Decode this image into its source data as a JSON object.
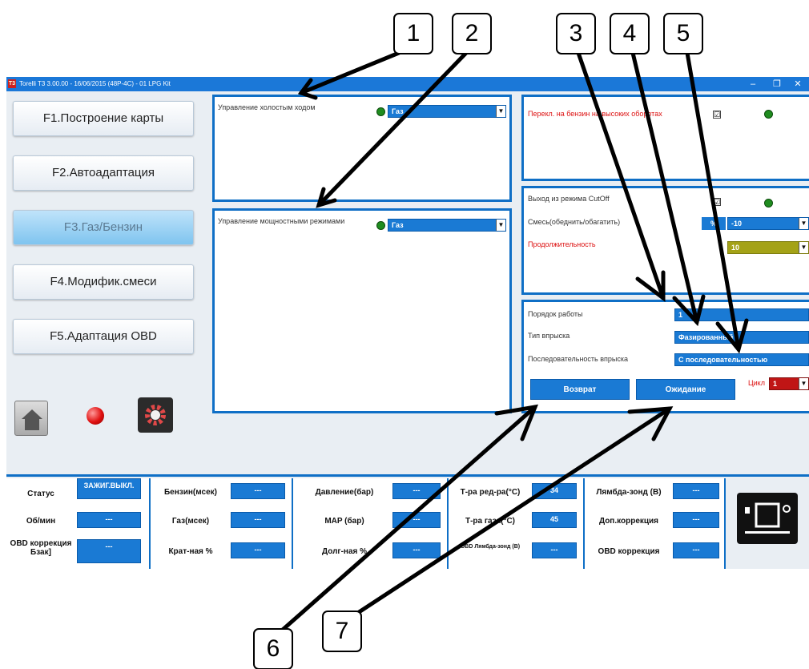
{
  "titlebar": {
    "app_icon": "T3",
    "title": "Torelli T3 3.00.00 - 16/06/2015 (48P-4C) - 01 LPG Kit",
    "minimize": "–",
    "maximize": "❐",
    "close": "✕"
  },
  "nav": [
    {
      "label": "F1.Построение карты"
    },
    {
      "label": "F2.Автоадаптация"
    },
    {
      "label": "F3.Газ/Бензин"
    },
    {
      "label": "F4.Модифик.смеси"
    },
    {
      "label": "F5.Адаптация OBD"
    }
  ],
  "idle": {
    "label": "Управление холостым ходом",
    "value": "Газ"
  },
  "power": {
    "label": "Управление мощностными режимами",
    "value": "Газ"
  },
  "switch_panel": {
    "label": "Перекл. на бензин на высоких оборотах",
    "checkbox": "☑"
  },
  "cutoff": {
    "label": "Выход из режима CutOff",
    "checkbox": "☑",
    "mix_label": "Смесь(обеднить/обагатить)",
    "percent_btn": "%",
    "mix_value": "-10",
    "duration_label": "Продолжительность",
    "duration_value": "10"
  },
  "injection": {
    "order_label": "Порядок работы",
    "order_value": "1",
    "type_label": "Тип впрыска",
    "type_value": "Фазированный",
    "sequence_label": "Последовательность впрыска",
    "sequence_value": "С последовательностью",
    "return_button": "Возврат",
    "wait_button": "Ожидание",
    "cycle_label": "Цикл",
    "cycle_value": "1"
  },
  "status": {
    "col1": [
      {
        "label": "Статус",
        "value": "ЗАЖИГ.ВЫКЛ."
      },
      {
        "label": "Об/мин",
        "value": "---"
      },
      {
        "label": "OBD коррекция Бзак]",
        "value": "---"
      }
    ],
    "col2": [
      {
        "label": "Бензин(мсек)",
        "value": "---"
      },
      {
        "label": "Газ(мсек)",
        "value": "---"
      },
      {
        "label": "Крат-ная %",
        "value": "---"
      }
    ],
    "col3": [
      {
        "label": "Давление(бар)",
        "value": "---"
      },
      {
        "label": "MAP (бар)",
        "value": "---"
      },
      {
        "label": "Долг-ная %",
        "value": "---"
      }
    ],
    "col4": [
      {
        "label": "Т-ра ред-ра(°C)",
        "value": "34"
      },
      {
        "label": "Т-ра газа(°C)",
        "value": "45"
      },
      {
        "label": "OBD Лямбда-зонд (В)",
        "value": "---"
      }
    ],
    "col5": [
      {
        "label": "Лямбда-зонд (В)",
        "value": "---"
      },
      {
        "label": "Доп.коррекция",
        "value": "---"
      },
      {
        "label": "OBD коррекция",
        "value": "---"
      }
    ]
  },
  "annotations": [
    "1",
    "2",
    "3",
    "4",
    "5",
    "6",
    "7"
  ],
  "colors": {
    "accent": "#1a7ad4",
    "panel_border": "#0f6fc6",
    "indicator": "#1f8c1f",
    "alert": "#e01010"
  }
}
